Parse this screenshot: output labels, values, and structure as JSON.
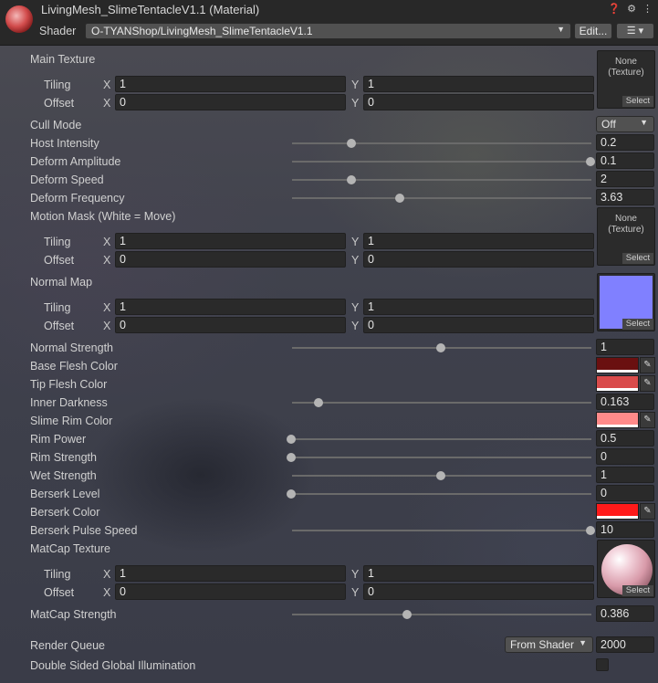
{
  "header": {
    "title": "LivingMesh_SlimeTentacleV1.1 (Material)",
    "shader_label": "Shader",
    "shader_value": "O-TYANShop/LivingMesh_SlimeTentacleV1.1",
    "edit_label": "Edit...",
    "icons": [
      "help-icon",
      "settings-icon",
      "menu-icon"
    ]
  },
  "texture_slot": {
    "none_label": "None\n(Texture)",
    "select_label": "Select"
  },
  "axis": {
    "x": "X",
    "y": "Y"
  },
  "labels": {
    "tiling": "Tiling",
    "offset": "Offset"
  },
  "props": {
    "main_texture": {
      "label": "Main Texture",
      "tiling_x": "1",
      "tiling_y": "1",
      "offset_x": "0",
      "offset_y": "0"
    },
    "cull_mode": {
      "label": "Cull Mode",
      "value": "Off"
    },
    "host_intensity": {
      "label": "Host Intensity",
      "value": "0.2",
      "slider": 0.2
    },
    "deform_amplitude": {
      "label": "Deform Amplitude",
      "value": "0.1",
      "slider": 1.0
    },
    "deform_speed": {
      "label": "Deform Speed",
      "value": "2",
      "slider": 0.2
    },
    "deform_frequency": {
      "label": "Deform Frequency",
      "value": "3.63",
      "slider": 0.363
    },
    "motion_mask": {
      "label": "Motion Mask (White = Move)",
      "tiling_x": "1",
      "tiling_y": "1",
      "offset_x": "0",
      "offset_y": "0"
    },
    "normal_map": {
      "label": "Normal Map",
      "tiling_x": "1",
      "tiling_y": "1",
      "offset_x": "0",
      "offset_y": "0",
      "preview_color": "#8080ff"
    },
    "normal_strength": {
      "label": "Normal Strength",
      "value": "1",
      "slider": 0.5
    },
    "base_flesh_color": {
      "label": "Base Flesh Color",
      "color": "#6a1010"
    },
    "tip_flesh_color": {
      "label": "Tip Flesh Color",
      "color": "#d94b4b"
    },
    "inner_darkness": {
      "label": "Inner Darkness",
      "value": "0.163",
      "slider": 0.09
    },
    "slime_rim_color": {
      "label": "Slime Rim Color",
      "color": "#ff8a8a"
    },
    "rim_power": {
      "label": "Rim Power",
      "value": "0.5",
      "slider": 0.0
    },
    "rim_strength": {
      "label": "Rim Strength",
      "value": "0",
      "slider": 0.0
    },
    "wet_strength": {
      "label": "Wet Strength",
      "value": "1",
      "slider": 0.5
    },
    "berserk_level": {
      "label": "Berserk Level",
      "value": "0",
      "slider": 0.0
    },
    "berserk_color": {
      "label": "Berserk Color",
      "color": "#ff1a1a"
    },
    "berserk_pulse_speed": {
      "label": "Berserk Pulse Speed",
      "value": "10",
      "slider": 1.0
    },
    "matcap_texture": {
      "label": "MatCap Texture",
      "tiling_x": "1",
      "tiling_y": "1",
      "offset_x": "0",
      "offset_y": "0"
    },
    "matcap_strength": {
      "label": "MatCap Strength",
      "value": "0.386",
      "slider": 0.386
    },
    "render_queue": {
      "label": "Render Queue",
      "mode": "From Shader",
      "value": "2000"
    },
    "double_sided_gi": {
      "label": "Double Sided Global Illumination",
      "checked": false
    }
  }
}
